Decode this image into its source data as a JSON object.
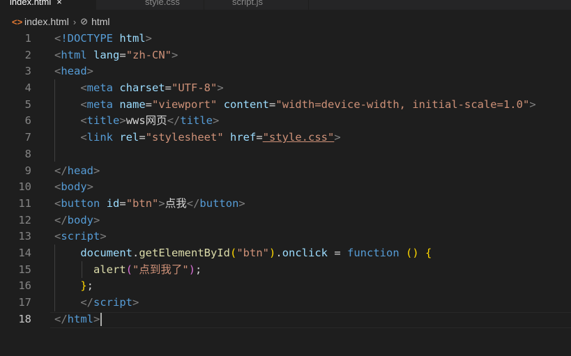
{
  "tabs": [
    {
      "label": "index.html",
      "active": true
    },
    {
      "label": "style.css",
      "active": false
    },
    {
      "label": "script.js",
      "active": false
    }
  ],
  "breadcrumb": {
    "file": "index.html",
    "element": "html"
  },
  "editor": {
    "current_line": 18,
    "line_numbers": [
      "1",
      "2",
      "3",
      "4",
      "5",
      "6",
      "7",
      "8",
      "9",
      "10",
      "11",
      "12",
      "13",
      "14",
      "15",
      "16",
      "17",
      "18"
    ],
    "tokens": {
      "l1_doctype": "!DOCTYPE",
      "l1_html": "html",
      "l2_html": "html",
      "l2_lang": "lang",
      "l2_lang_val": "\"zh-CN\"",
      "l3_head": "head",
      "l4_meta": "meta",
      "l4_charset": "charset",
      "l4_charset_val": "\"UTF-8\"",
      "l5_meta": "meta",
      "l5_name": "name",
      "l5_name_val": "\"viewport\"",
      "l5_content": "content",
      "l5_content_val": "\"width=device-width, initial-scale=1.0\"",
      "l6_title": "title",
      "l6_text": "wws网页",
      "l6_title_close": "title",
      "l7_link": "link",
      "l7_rel": "rel",
      "l7_rel_val": "\"stylesheet\"",
      "l7_href": "href",
      "l7_href_val": "\"style.css\"",
      "l9_head": "head",
      "l10_body": "body",
      "l11_button": "button",
      "l11_id": "id",
      "l11_id_val": "\"btn\"",
      "l11_text": "点我",
      "l11_button_close": "button",
      "l12_body": "body",
      "l13_script": "script",
      "l14_document": "document",
      "l14_method": "getElementById",
      "l14_arg": "\"btn\"",
      "l14_onclick": "onclick",
      "l14_function": "function",
      "l15_alert": "alert",
      "l15_str": "\"点到我了\"",
      "l17_script": "script",
      "l18_html": "html"
    }
  },
  "colors": {
    "background": "#1e1e1e",
    "tag": "#569cd6",
    "attribute": "#9cdcfe",
    "string": "#ce9178",
    "function": "#dcdcaa",
    "bracket_gold": "#ffd700",
    "bracket_pink": "#da70d6",
    "html_icon": "#e37933"
  }
}
